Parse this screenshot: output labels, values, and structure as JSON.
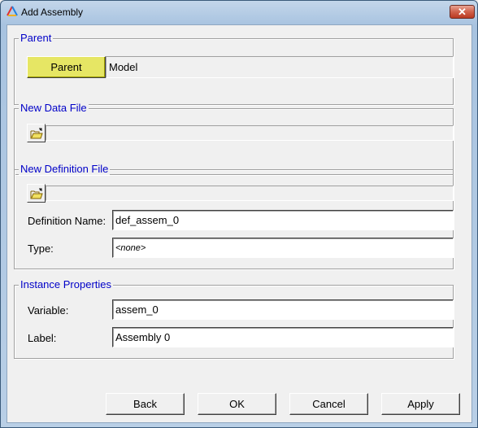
{
  "window": {
    "title": "Add Assembly",
    "close_glyph": "✕"
  },
  "parent_group": {
    "legend": "Parent",
    "button_label": "Parent",
    "value": "Model",
    "button_color": "#e6e664"
  },
  "data_file_group": {
    "legend": "New Data File",
    "path": ""
  },
  "definition_file_group": {
    "legend": "New Definition File",
    "path": "",
    "definition_name_label": "Definition Name:",
    "definition_name_value": "def_assem_0",
    "type_label": "Type:",
    "type_value": "<none>"
  },
  "instance_group": {
    "legend": "Instance Properties",
    "variable_label": "Variable:",
    "variable_value": "assem_0",
    "label_label": "Label:",
    "label_value": "Assembly 0"
  },
  "footer": {
    "back": "Back",
    "ok": "OK",
    "cancel": "Cancel",
    "apply": "Apply"
  },
  "colors": {
    "legend_text": "#0000c8"
  }
}
